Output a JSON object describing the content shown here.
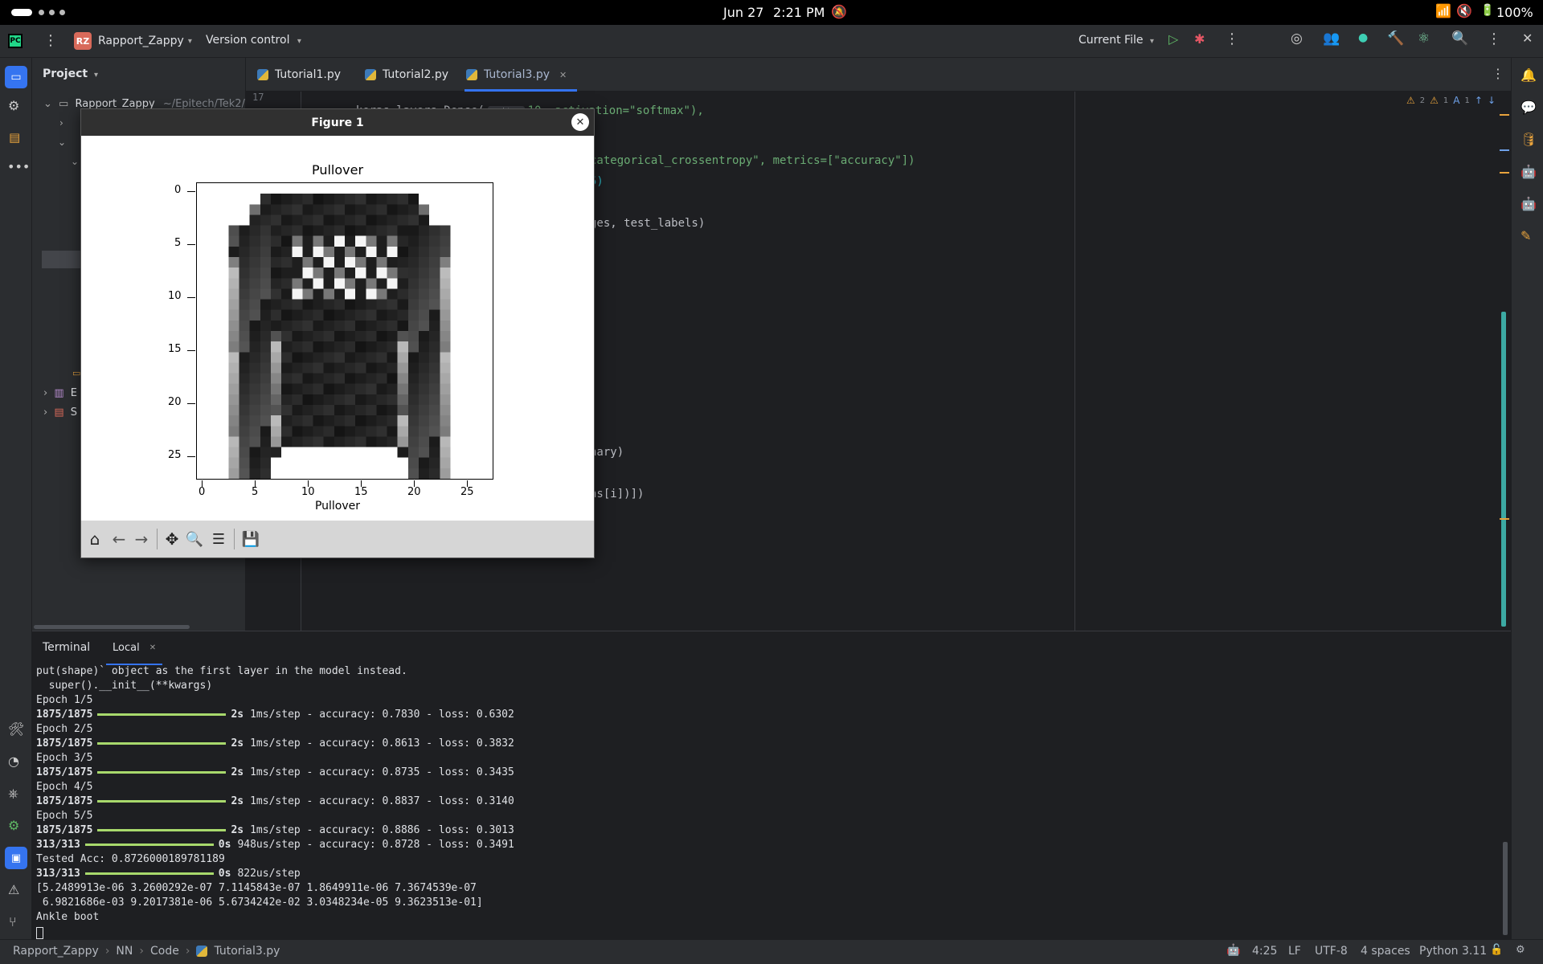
{
  "system": {
    "date": "Jun 27",
    "time": "2:21 PM",
    "battery": "100%"
  },
  "titlebar": {
    "project_badge": "RZ",
    "project_name": "Rapport_Zappy",
    "vcs_label": "Version control",
    "run_config": "Current File"
  },
  "project_panel": {
    "title": "Project",
    "root_name": "Rapport_Zappy",
    "root_path": "~/Epitech/Tek2/Ra",
    "items_visible": [
      "E",
      "S"
    ]
  },
  "tabs": [
    {
      "label": "Tutorial1.py",
      "active": false
    },
    {
      "label": "Tutorial2.py",
      "active": false
    },
    {
      "label": "Tutorial3.py",
      "active": true
    }
  ],
  "editor": {
    "first_line_number": "17",
    "line17_code": "keras.layers.Dense(",
    "line17_hint": "units:",
    "line17_rest": "10, activation=\"softmax\"),",
    "frag_compile": "categorical_crossentropy\", metrics=[\"accuracy\"])",
    "frag_fit": "5)",
    "frag_eval": "ges, test_labels)",
    "frag_binary": "nary)",
    "frag_pred": "ns[i])])",
    "warnings_a": "2",
    "warnings_b": "1",
    "typos": "1"
  },
  "figure": {
    "window_title": "Figure 1",
    "plot_title": "Pullover",
    "xlabel": "Pullover",
    "x_ticks": [
      "0",
      "5",
      "10",
      "15",
      "20",
      "25"
    ],
    "y_ticks": [
      "0",
      "5",
      "10",
      "15",
      "20",
      "25"
    ],
    "toolbar_icons": [
      "home-icon",
      "back-icon",
      "forward-icon",
      "pan-icon",
      "zoom-icon",
      "configure-icon",
      "save-icon"
    ]
  },
  "terminal": {
    "tab_title": "Terminal",
    "session_tab": "Local",
    "lines": [
      {
        "kind": "text",
        "text": "put(shape)` object as the first layer in the model instead."
      },
      {
        "kind": "text",
        "text": "  super().__init__(**kwargs)"
      },
      {
        "kind": "text",
        "text": "Epoch 1/5"
      },
      {
        "kind": "progress",
        "steps": "1875/1875",
        "time": "2s",
        "rest": "1ms/step - accuracy: 0.7830 - loss: 0.6302"
      },
      {
        "kind": "text",
        "text": "Epoch 2/5"
      },
      {
        "kind": "progress",
        "steps": "1875/1875",
        "time": "2s",
        "rest": "1ms/step - accuracy: 0.8613 - loss: 0.3832"
      },
      {
        "kind": "text",
        "text": "Epoch 3/5"
      },
      {
        "kind": "progress",
        "steps": "1875/1875",
        "time": "2s",
        "rest": "1ms/step - accuracy: 0.8735 - loss: 0.3435"
      },
      {
        "kind": "text",
        "text": "Epoch 4/5"
      },
      {
        "kind": "progress",
        "steps": "1875/1875",
        "time": "2s",
        "rest": "1ms/step - accuracy: 0.8837 - loss: 0.3140"
      },
      {
        "kind": "text",
        "text": "Epoch 5/5"
      },
      {
        "kind": "progress",
        "steps": "1875/1875",
        "time": "2s",
        "rest": "1ms/step - accuracy: 0.8886 - loss: 0.3013"
      },
      {
        "kind": "progress",
        "steps": "313/313",
        "time": "0s",
        "rest": "948us/step - accuracy: 0.8728 - loss: 0.3491"
      },
      {
        "kind": "text",
        "text": "Tested Acc: 0.8726000189781189"
      },
      {
        "kind": "progress",
        "steps": "313/313",
        "time": "0s",
        "rest": "822us/step"
      },
      {
        "kind": "text",
        "text": "[5.2489913e-06 3.2600292e-07 7.1145843e-07 1.8649911e-06 7.3674539e-07"
      },
      {
        "kind": "text",
        "text": " 6.9821686e-03 9.2017381e-06 5.6734242e-02 3.0348234e-05 9.3623513e-01]"
      },
      {
        "kind": "text",
        "text": "Ankle boot"
      }
    ]
  },
  "statusbar": {
    "breadcrumb": [
      "Rapport_Zappy",
      "NN",
      "Code",
      "Tutorial3.py"
    ],
    "position": "4:25",
    "line_sep": "LF",
    "encoding": "UTF-8",
    "indent": "4 spaces",
    "interpreter": "Python 3.11"
  },
  "colors": {
    "accent": "#3574f0",
    "progress": "#a8d96c",
    "warning": "#e8a33d"
  }
}
